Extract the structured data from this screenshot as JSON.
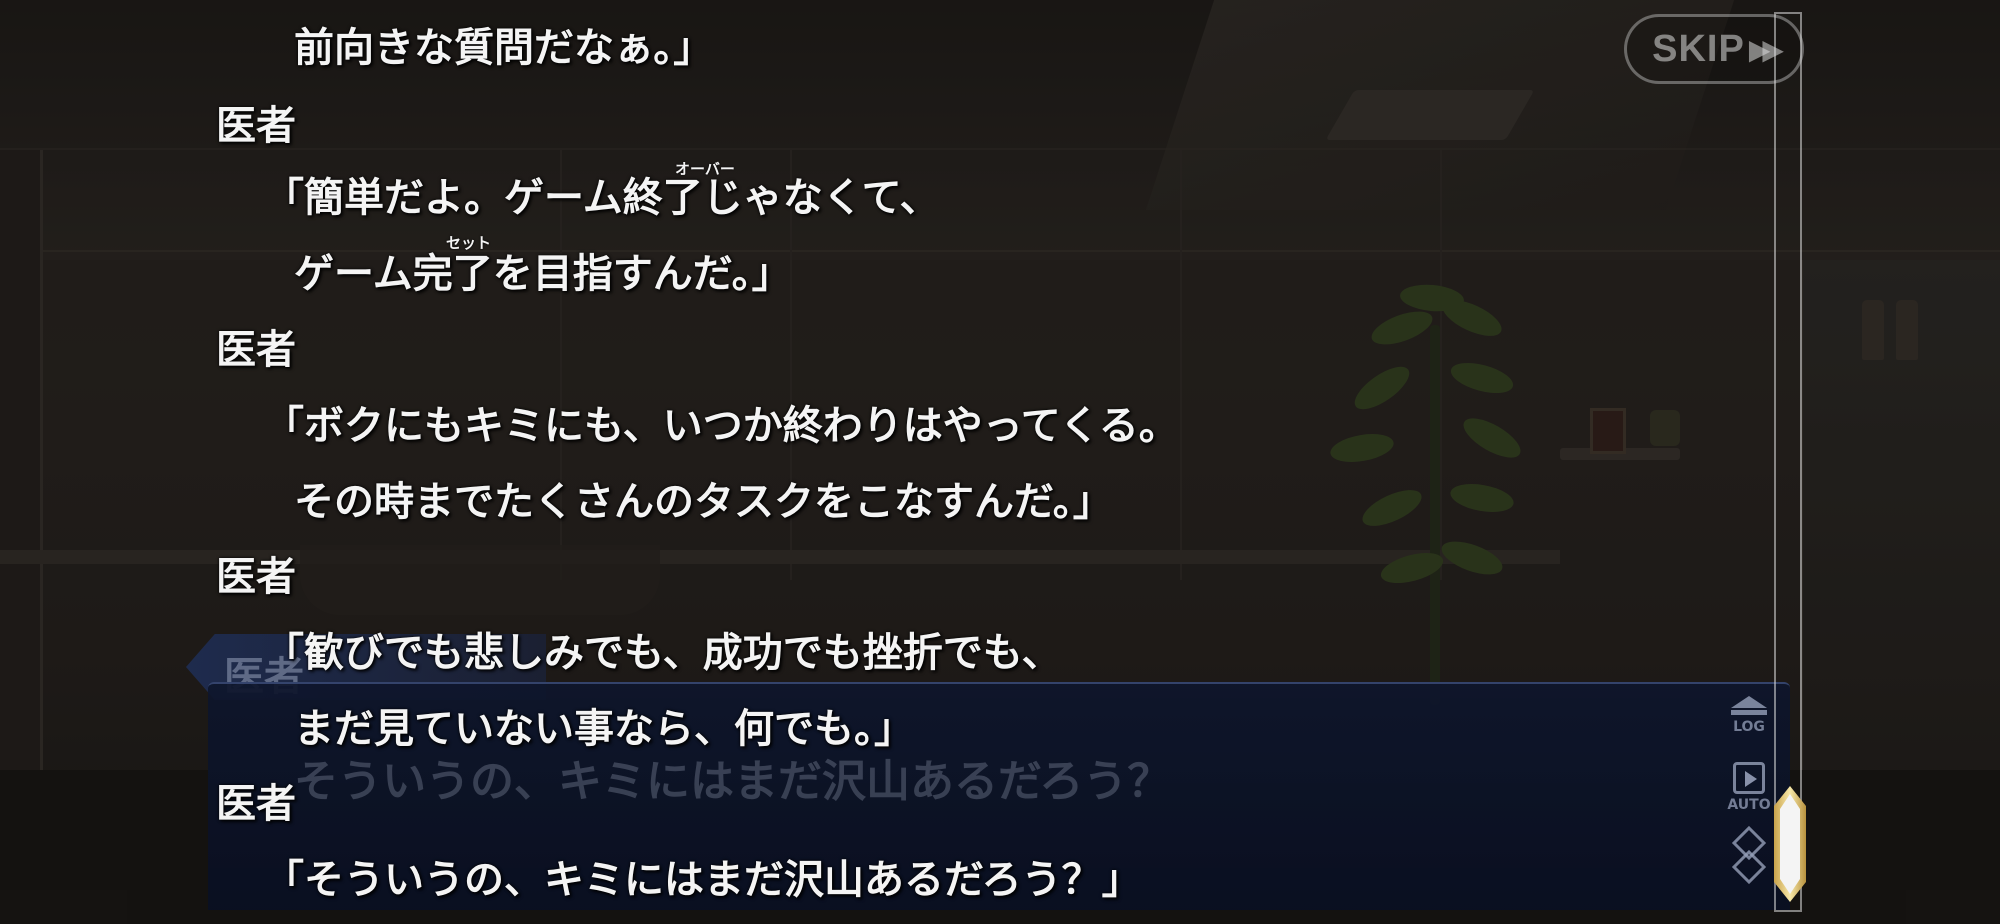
{
  "skip_button": {
    "label": "SKIP",
    "icon": "fast-forward-icon"
  },
  "backlog": {
    "entries": [
      {
        "lines": [
          "前向きな質問だなぁ。」"
        ]
      },
      {
        "speaker": "医者",
        "lines": [
          "「簡単だよ。ゲーム終了じゃなくて、",
          "ゲーム完了を目指すんだ。」"
        ],
        "ruby": [
          "オーバー",
          "セット"
        ]
      },
      {
        "speaker": "医者",
        "lines": [
          "「ボクにもキミにも、いつか終わりはやってくる。",
          "その時までたくさんのタスクをこなすんだ。」"
        ]
      },
      {
        "speaker": "医者",
        "lines": [
          "「歓びでも悲しみでも、成功でも挫折でも、",
          "まだ見ていない事なら、何でも。」"
        ]
      },
      {
        "speaker": "医者",
        "lines": [
          "「そういうの、キミにはまだ沢山あるだろう？」"
        ]
      }
    ]
  },
  "message_window": {
    "speaker": "医者",
    "text": "そういうの、キミにはまだ沢山あるだろう？",
    "log_label": "LOG",
    "auto_label": "AUTO"
  },
  "scrollbar": {
    "position": 1.0
  }
}
